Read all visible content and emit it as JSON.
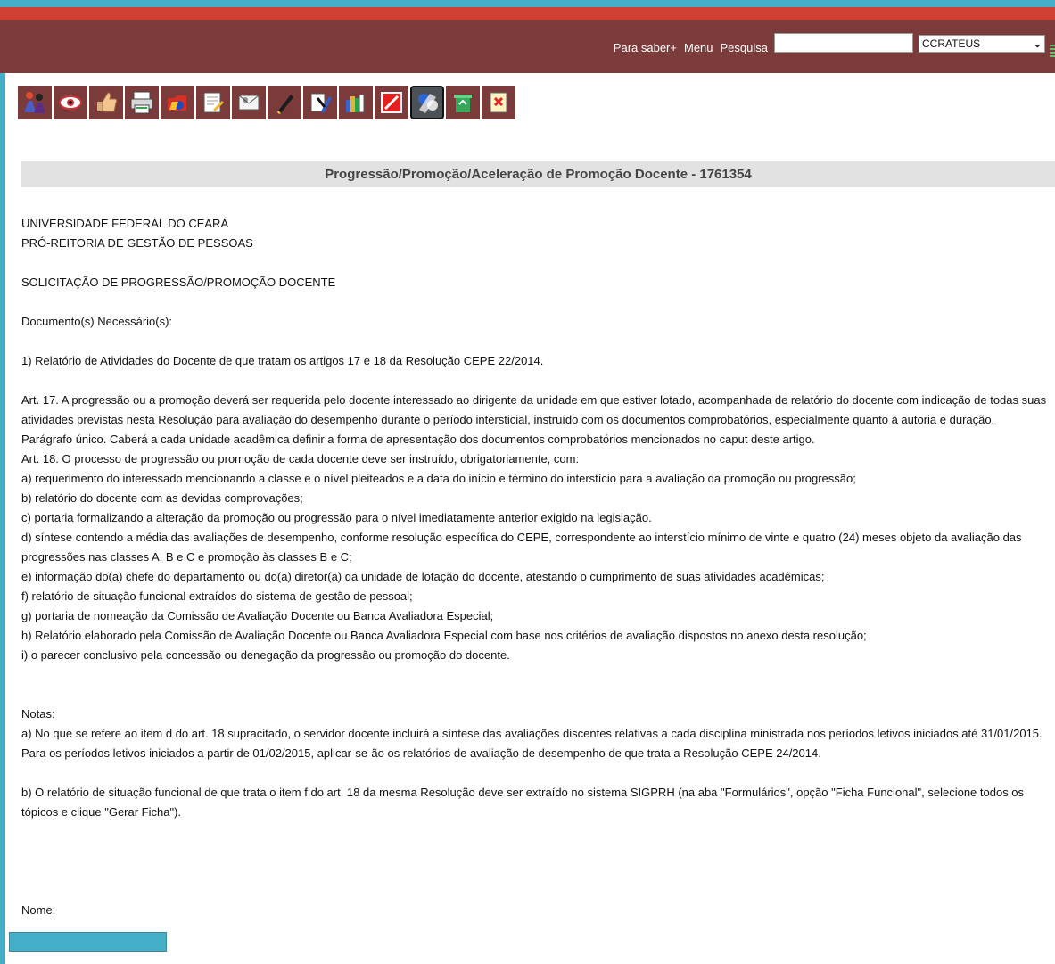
{
  "header": {
    "nav": {
      "para_saber": "Para saber+",
      "menu": "Menu",
      "pesquisa": "Pesquisa"
    },
    "search_placeholder": "",
    "select_value": "CCRATEUS"
  },
  "toolbar": {
    "buttons": [
      {
        "icon": "people-icon"
      },
      {
        "icon": "eye-icon"
      },
      {
        "icon": "thumbs-up-icon"
      },
      {
        "icon": "printer-icon"
      },
      {
        "icon": "red-folder-icon"
      },
      {
        "icon": "edit-document-icon"
      },
      {
        "icon": "envelope-icon"
      },
      {
        "icon": "pen-icon"
      },
      {
        "icon": "pencil-icon"
      },
      {
        "icon": "books-icon"
      },
      {
        "icon": "red-stop-icon"
      },
      {
        "icon": "globe-network-icon"
      },
      {
        "icon": "recycle-bin-icon"
      },
      {
        "icon": "cancel-document-icon"
      }
    ]
  },
  "page_title": "Progressão/Promoção/Aceleração de Promoção Docente - 1761354",
  "document": {
    "institution": "UNIVERSIDADE FEDERAL DO CEARÁ",
    "department": "PRÓ-REITORIA DE GESTÃO DE PESSOAS",
    "request_title": "SOLICITAÇÃO DE PROGRESSÃO/PROMOÇÃO DOCENTE",
    "required_docs_label": "Documento(s) Necessário(s):",
    "item_1": "1) Relatório de Atividades do Docente de que tratam os artigos 17 e 18 da Resolução CEPE 22/2014.",
    "art17": "Art. 17. A progressão ou a promoção deverá ser requerida pelo docente interessado ao dirigente da unidade em que estiver lotado, acompanhada de relatório do docente com indicação de todas suas atividades previstas nesta Resolução para avaliação do desempenho durante o período intersticial, instruído com os documentos comprobatórios, especialmente quanto à autoria e duração.",
    "paragrafo": "Parágrafo único. Caberá a cada unidade acadêmica definir a forma de apresentação dos documentos comprobatórios mencionados no caput deste artigo.",
    "art18": "Art. 18. O processo de progressão ou promoção de cada docente deve ser instruído, obrigatoriamente, com:",
    "items": [
      "a) requerimento do interessado mencionando a classe e o nível pleiteados e a data do início e término do interstício para a avaliação da promoção ou progressão;",
      "b) relatório do docente com as devidas comprovações;",
      "c) portaria formalizando a alteração da promoção ou progressão para o nível imediatamente anterior exigido na legislação.",
      "d) síntese contendo a média das avaliações de desempenho, conforme resolução específica do CEPE, correspondente ao interstício mínimo de vinte e quatro (24) meses objeto da avaliação das progressões nas classes A, B e C e promoção às classes B e C;",
      "e) informação do(a) chefe do departamento ou do(a) diretor(a) da unidade de lotação do docente, atestando o cumprimento de suas atividades acadêmicas;",
      "f) relatório de situação funcional extraídos do sistema de gestão de pessoal;",
      "g) portaria de nomeação da Comissão de Avaliação Docente ou Banca Avaliadora Especial;",
      "h) Relatório elaborado pela Comissão de Avaliação Docente ou Banca Avaliadora Especial com base nos critérios de avaliação dispostos no anexo desta resolução;",
      "i) o parecer conclusivo pela concessão ou denegação da progressão ou promoção do docente."
    ],
    "notes_label": "Notas:",
    "note_a": "a) No que se refere ao item d do art. 18 supracitado, o servidor docente incluirá a síntese das avaliações discentes relativas a cada disciplina ministrada nos períodos letivos iniciados até 31/01/2015. Para os períodos letivos iniciados a partir de 01/02/2015, aplicar-se-ão os relatórios de avaliação de desempenho de que trata a Resolução CEPE 24/2014.",
    "note_b": "b) O relatório de situação funcional de que trata o item f do art. 18 da mesma Resolução deve ser extraído no sistema SIGPRH (na aba \"Formulários\", opção \"Ficha Funcional\", selecione todos os tópicos e clique \"Gerar Ficha\").",
    "nome_label": "Nome:"
  },
  "colors": {
    "header_bg": "#7a3b3a",
    "header_red": "#cf3f32",
    "frame_blue": "#45aec9",
    "title_bg": "#e2e2e2"
  }
}
